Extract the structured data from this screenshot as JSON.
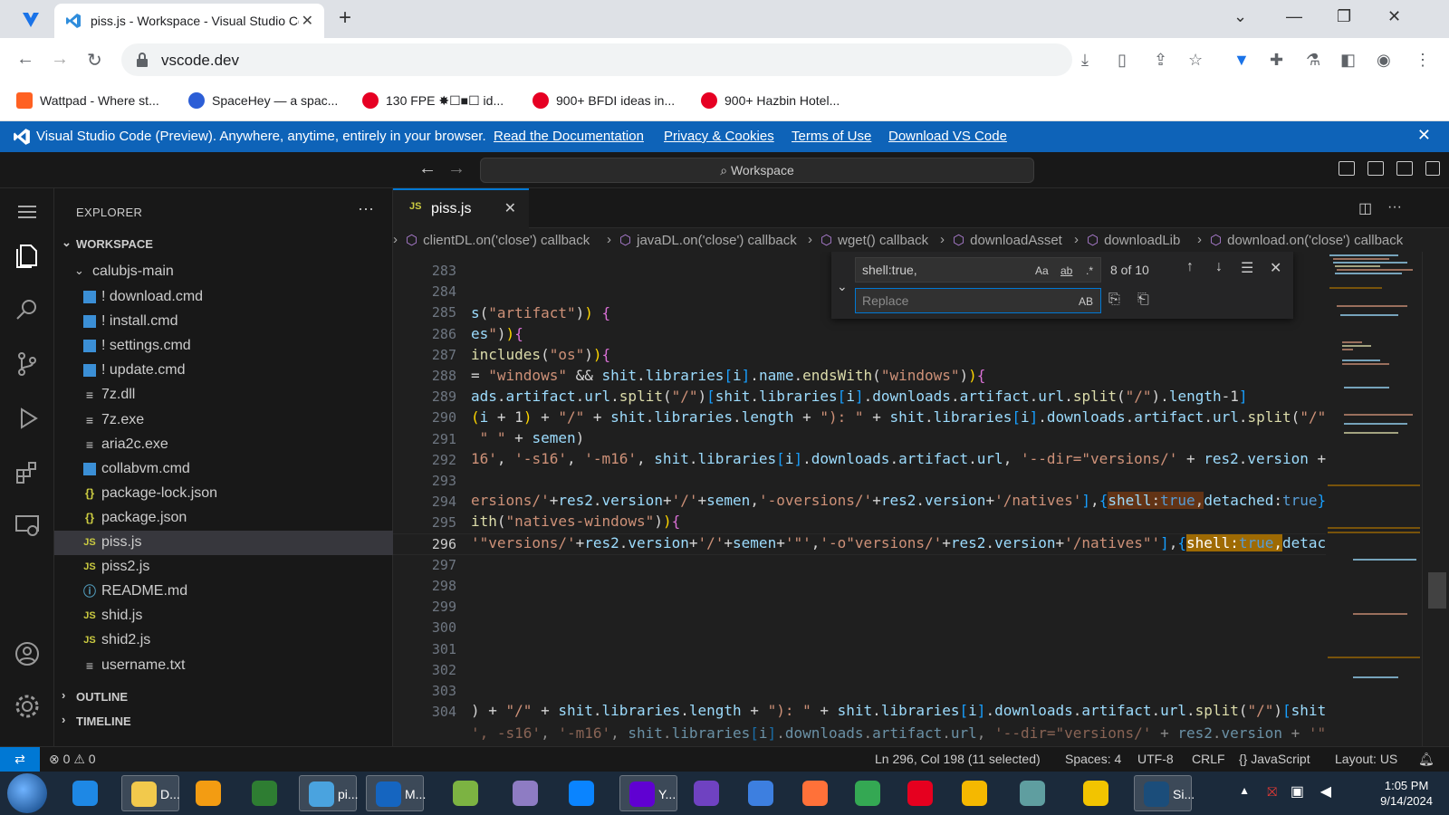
{
  "browser": {
    "tab_title": "piss.js - Workspace - Visual Studio Code",
    "tab_close": "✕",
    "new_tab": "+",
    "url": "vscode.dev",
    "bookmarks": [
      {
        "label": "Wattpad - Where st...",
        "color": "#ff6122"
      },
      {
        "label": "SpaceHey — a spac...",
        "color": "#2c5ed6"
      },
      {
        "label": "130 FPE ✸☐■☐ id...",
        "color": "#e60023"
      },
      {
        "label": "900+ BFDI ideas in...",
        "color": "#e60023"
      },
      {
        "label": "900+ Hazbin Hotel...",
        "color": "#e60023"
      }
    ]
  },
  "banner": {
    "text": "Visual Studio Code (Preview). Anywhere, anytime, entirely in your browser.",
    "links": [
      "Read the Documentation",
      "Privacy & Cookies",
      "Terms of Use",
      "Download VS Code"
    ]
  },
  "titlebar": {
    "command_center": "Workspace"
  },
  "sidebar": {
    "header": "EXPLORER",
    "workspace": "WORKSPACE",
    "folder": "calubjs-main",
    "files": [
      {
        "name": "! download.cmd",
        "type": "win"
      },
      {
        "name": "! install.cmd",
        "type": "win"
      },
      {
        "name": "! settings.cmd",
        "type": "win"
      },
      {
        "name": "! update.cmd",
        "type": "win"
      },
      {
        "name": "7z.dll",
        "type": "txt"
      },
      {
        "name": "7z.exe",
        "type": "txt"
      },
      {
        "name": "aria2c.exe",
        "type": "txt"
      },
      {
        "name": "collabvm.cmd",
        "type": "win"
      },
      {
        "name": "package-lock.json",
        "type": "json"
      },
      {
        "name": "package.json",
        "type": "json"
      },
      {
        "name": "piss.js",
        "type": "js",
        "selected": true
      },
      {
        "name": "piss2.js",
        "type": "js"
      },
      {
        "name": "README.md",
        "type": "info"
      },
      {
        "name": "shid.js",
        "type": "js"
      },
      {
        "name": "shid2.js",
        "type": "js"
      },
      {
        "name": "username.txt",
        "type": "txt"
      }
    ],
    "outline": "OUTLINE",
    "timeline": "TIMELINE"
  },
  "editor": {
    "tab_label": "piss.js",
    "tab_lang": "JS",
    "breadcrumbs": [
      "clientDL.on('close') callback",
      "javaDL.on('close') callback",
      "wget() callback",
      "downloadAsset",
      "downloadLib",
      "download.on('close') callback"
    ],
    "line_numbers": [
      "283",
      "284",
      "285",
      "286",
      "287",
      "288",
      "289",
      "290",
      "291",
      "292",
      "293",
      "294",
      "295",
      "296",
      "297",
      "298",
      "299",
      "300",
      "301",
      "302",
      "303",
      "304"
    ],
    "current_line": "296"
  },
  "find": {
    "query": "shell:true,",
    "replace_placeholder": "Replace",
    "count": "8 of 10",
    "opt_case": "Aa",
    "opt_word": "ab",
    "opt_regex": ".*",
    "opt_preserve": "AB"
  },
  "statusbar": {
    "errors": "0",
    "warnings": "0",
    "position": "Ln 296, Col 198 (11 selected)",
    "spaces": "Spaces: 4",
    "encoding": "UTF-8",
    "eol": "CRLF",
    "language": "JavaScript",
    "layout": "Layout: US"
  },
  "taskbar": {
    "items": [
      {
        "label": "",
        "color": "#1e88e5"
      },
      {
        "label": "D...",
        "color": "#f2c94c"
      },
      {
        "label": "",
        "color": "#f39c12"
      },
      {
        "label": "",
        "color": "#2e7d32"
      },
      {
        "label": "pi...",
        "color": "#4aa3df"
      },
      {
        "label": "M...",
        "color": "#1565c0"
      },
      {
        "label": "",
        "color": "#7cb342"
      },
      {
        "label": "",
        "color": "#8e7cc3"
      },
      {
        "label": "",
        "color": "#0a84ff"
      },
      {
        "label": "Y...",
        "color": "#6001d2"
      },
      {
        "label": "",
        "color": "#6f42c1"
      },
      {
        "label": "",
        "color": "#3d7fe0"
      },
      {
        "label": "",
        "color": "#ff7139"
      },
      {
        "label": "",
        "color": "#34a853"
      },
      {
        "label": "",
        "color": "#e6001f"
      },
      {
        "label": "",
        "color": "#f5b800"
      },
      {
        "label": "",
        "color": "#5f9ea0"
      },
      {
        "label": "",
        "color": "#f2c400"
      },
      {
        "label": "Si...",
        "color": "#1b4d7a"
      }
    ],
    "time": "1:05 PM",
    "date": "9/14/2024"
  },
  "colors": {
    "accent": "#0078d4",
    "banner": "#0e63b8",
    "find_match": "#623315",
    "current_match": "#9e6a03"
  }
}
